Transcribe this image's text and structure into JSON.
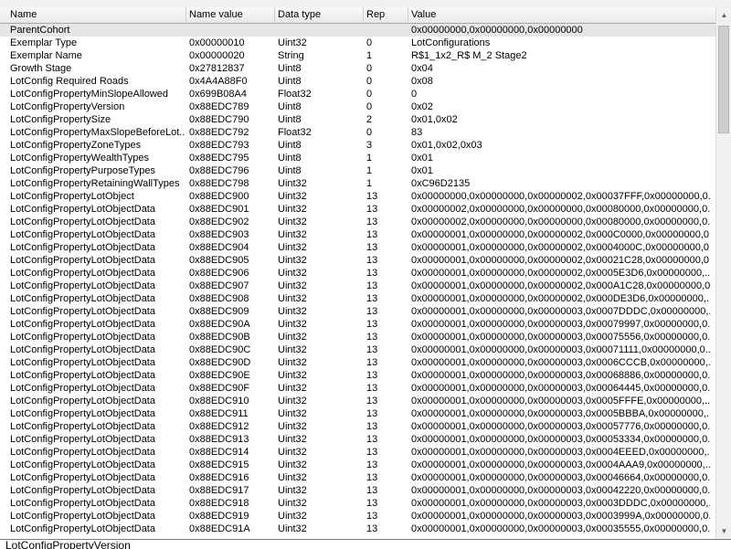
{
  "columns": {
    "name": "Name",
    "name_value": "Name value",
    "data_type": "Data type",
    "rep": "Rep",
    "value": "Value"
  },
  "rows": [
    {
      "name": "ParentCohort",
      "name_value": "",
      "data_type": "",
      "rep": "",
      "value": "0x00000000,0x00000000,0x00000000"
    },
    {
      "name": "Exemplar Type",
      "name_value": "0x00000010",
      "data_type": "Uint32",
      "rep": "0",
      "value": "LotConfigurations"
    },
    {
      "name": "Exemplar Name",
      "name_value": "0x00000020",
      "data_type": "String",
      "rep": "1",
      "value": "R$1_1x2_R$ M_2 Stage2"
    },
    {
      "name": "Growth Stage",
      "name_value": "0x27812837",
      "data_type": "Uint8",
      "rep": "0",
      "value": "0x04"
    },
    {
      "name": "LotConfig Required Roads",
      "name_value": "0x4A4A88F0",
      "data_type": "Uint8",
      "rep": "0",
      "value": "0x08"
    },
    {
      "name": "LotConfigPropertyMinSlopeAllowed",
      "name_value": "0x699B08A4",
      "data_type": "Float32",
      "rep": "0",
      "value": "0"
    },
    {
      "name": "LotConfigPropertyVersion",
      "name_value": "0x88EDC789",
      "data_type": "Uint8",
      "rep": "0",
      "value": "0x02"
    },
    {
      "name": "LotConfigPropertySize",
      "name_value": "0x88EDC790",
      "data_type": "Uint8",
      "rep": "2",
      "value": "0x01,0x02"
    },
    {
      "name": "LotConfigPropertyMaxSlopeBeforeLot...",
      "name_value": "0x88EDC792",
      "data_type": "Float32",
      "rep": "0",
      "value": "83"
    },
    {
      "name": "LotConfigPropertyZoneTypes",
      "name_value": "0x88EDC793",
      "data_type": "Uint8",
      "rep": "3",
      "value": "0x01,0x02,0x03"
    },
    {
      "name": "LotConfigPropertyWealthTypes",
      "name_value": "0x88EDC795",
      "data_type": "Uint8",
      "rep": "1",
      "value": "0x01"
    },
    {
      "name": "LotConfigPropertyPurposeTypes",
      "name_value": "0x88EDC796",
      "data_type": "Uint8",
      "rep": "1",
      "value": "0x01"
    },
    {
      "name": "LotConfigPropertyRetainingWallTypes",
      "name_value": "0x88EDC798",
      "data_type": "Uint32",
      "rep": "1",
      "value": "0xC96D2135"
    },
    {
      "name": "LotConfigPropertyLotObject",
      "name_value": "0x88EDC900",
      "data_type": "Uint32",
      "rep": "13",
      "value": "0x00000000,0x00000000,0x00000002,0x00037FFF,0x00000000,0..."
    },
    {
      "name": "LotConfigPropertyLotObjectData",
      "name_value": "0x88EDC901",
      "data_type": "Uint32",
      "rep": "13",
      "value": "0x00000002,0x00000000,0x00000000,0x00080000,0x00000000,0..."
    },
    {
      "name": "LotConfigPropertyLotObjectData",
      "name_value": "0x88EDC902",
      "data_type": "Uint32",
      "rep": "13",
      "value": "0x00000002,0x00000000,0x00000000,0x00080000,0x00000000,0..."
    },
    {
      "name": "LotConfigPropertyLotObjectData",
      "name_value": "0x88EDC903",
      "data_type": "Uint32",
      "rep": "13",
      "value": "0x00000001,0x00000000,0x00000002,0x000C0000,0x00000000,0..."
    },
    {
      "name": "LotConfigPropertyLotObjectData",
      "name_value": "0x88EDC904",
      "data_type": "Uint32",
      "rep": "13",
      "value": "0x00000001,0x00000000,0x00000002,0x0004000C,0x00000000,0..."
    },
    {
      "name": "LotConfigPropertyLotObjectData",
      "name_value": "0x88EDC905",
      "data_type": "Uint32",
      "rep": "13",
      "value": "0x00000001,0x00000000,0x00000002,0x00021C28,0x00000000,0..."
    },
    {
      "name": "LotConfigPropertyLotObjectData",
      "name_value": "0x88EDC906",
      "data_type": "Uint32",
      "rep": "13",
      "value": "0x00000001,0x00000000,0x00000002,0x0005E3D6,0x00000000,..."
    },
    {
      "name": "LotConfigPropertyLotObjectData",
      "name_value": "0x88EDC907",
      "data_type": "Uint32",
      "rep": "13",
      "value": "0x00000001,0x00000000,0x00000002,0x000A1C28,0x00000000,0..."
    },
    {
      "name": "LotConfigPropertyLotObjectData",
      "name_value": "0x88EDC908",
      "data_type": "Uint32",
      "rep": "13",
      "value": "0x00000001,0x00000000,0x00000002,0x000DE3D6,0x00000000,..."
    },
    {
      "name": "LotConfigPropertyLotObjectData",
      "name_value": "0x88EDC909",
      "data_type": "Uint32",
      "rep": "13",
      "value": "0x00000001,0x00000000,0x00000003,0x0007DDDC,0x00000000,..."
    },
    {
      "name": "LotConfigPropertyLotObjectData",
      "name_value": "0x88EDC90A",
      "data_type": "Uint32",
      "rep": "13",
      "value": "0x00000001,0x00000000,0x00000003,0x00079997,0x00000000,0..."
    },
    {
      "name": "LotConfigPropertyLotObjectData",
      "name_value": "0x88EDC90B",
      "data_type": "Uint32",
      "rep": "13",
      "value": "0x00000001,0x00000000,0x00000003,0x00075556,0x00000000,0..."
    },
    {
      "name": "LotConfigPropertyLotObjectData",
      "name_value": "0x88EDC90C",
      "data_type": "Uint32",
      "rep": "13",
      "value": "0x00000001,0x00000000,0x00000003,0x00071111,0x00000000,0..."
    },
    {
      "name": "LotConfigPropertyLotObjectData",
      "name_value": "0x88EDC90D",
      "data_type": "Uint32",
      "rep": "13",
      "value": "0x00000001,0x00000000,0x00000003,0x0006CCCB,0x00000000,..."
    },
    {
      "name": "LotConfigPropertyLotObjectData",
      "name_value": "0x88EDC90E",
      "data_type": "Uint32",
      "rep": "13",
      "value": "0x00000001,0x00000000,0x00000003,0x00068886,0x00000000,0..."
    },
    {
      "name": "LotConfigPropertyLotObjectData",
      "name_value": "0x88EDC90F",
      "data_type": "Uint32",
      "rep": "13",
      "value": "0x00000001,0x00000000,0x00000003,0x00064445,0x00000000,0..."
    },
    {
      "name": "LotConfigPropertyLotObjectData",
      "name_value": "0x88EDC910",
      "data_type": "Uint32",
      "rep": "13",
      "value": "0x00000001,0x00000000,0x00000003,0x0005FFFE,0x00000000,..."
    },
    {
      "name": "LotConfigPropertyLotObjectData",
      "name_value": "0x88EDC911",
      "data_type": "Uint32",
      "rep": "13",
      "value": "0x00000001,0x00000000,0x00000003,0x0005BBBA,0x00000000,..."
    },
    {
      "name": "LotConfigPropertyLotObjectData",
      "name_value": "0x88EDC912",
      "data_type": "Uint32",
      "rep": "13",
      "value": "0x00000001,0x00000000,0x00000003,0x00057776,0x00000000,0..."
    },
    {
      "name": "LotConfigPropertyLotObjectData",
      "name_value": "0x88EDC913",
      "data_type": "Uint32",
      "rep": "13",
      "value": "0x00000001,0x00000000,0x00000003,0x00053334,0x00000000,0..."
    },
    {
      "name": "LotConfigPropertyLotObjectData",
      "name_value": "0x88EDC914",
      "data_type": "Uint32",
      "rep": "13",
      "value": "0x00000001,0x00000000,0x00000003,0x0004EEED,0x00000000,..."
    },
    {
      "name": "LotConfigPropertyLotObjectData",
      "name_value": "0x88EDC915",
      "data_type": "Uint32",
      "rep": "13",
      "value": "0x00000001,0x00000000,0x00000003,0x0004AAA9,0x00000000,..."
    },
    {
      "name": "LotConfigPropertyLotObjectData",
      "name_value": "0x88EDC916",
      "data_type": "Uint32",
      "rep": "13",
      "value": "0x00000001,0x00000000,0x00000003,0x00046664,0x00000000,0..."
    },
    {
      "name": "LotConfigPropertyLotObjectData",
      "name_value": "0x88EDC917",
      "data_type": "Uint32",
      "rep": "13",
      "value": "0x00000001,0x00000000,0x00000003,0x00042220,0x00000000,0..."
    },
    {
      "name": "LotConfigPropertyLotObjectData",
      "name_value": "0x88EDC918",
      "data_type": "Uint32",
      "rep": "13",
      "value": "0x00000001,0x00000000,0x00000003,0x0003DDDC,0x00000000,..."
    },
    {
      "name": "LotConfigPropertyLotObjectData",
      "name_value": "0x88EDC919",
      "data_type": "Uint32",
      "rep": "13",
      "value": "0x00000001,0x00000000,0x00000003,0x0003999A,0x00000000,0..."
    },
    {
      "name": "LotConfigPropertyLotObjectData",
      "name_value": "0x88EDC91A",
      "data_type": "Uint32",
      "rep": "13",
      "value": "0x00000001,0x00000000,0x00000003,0x00035555,0x00000000,0..."
    }
  ],
  "selected_row": 0,
  "bottom_peek_text": "LotConfigPropertyVersion",
  "scrollbar": {
    "up_icon": "▲",
    "down_icon": "▼"
  },
  "colors": {
    "selected_row_bg": "#e6e6e6",
    "header_border": "#a9a9a9"
  }
}
